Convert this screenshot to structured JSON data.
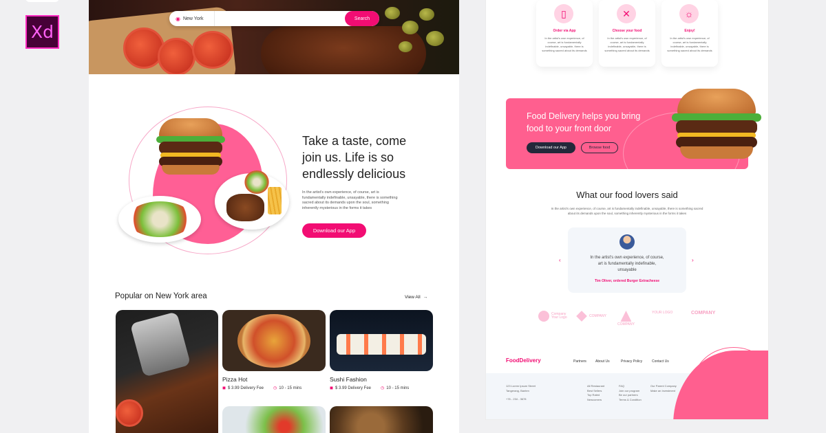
{
  "app": {
    "logo_text": "Xd",
    "accent_color": "#f20d73",
    "secondary_pink": "#ff5f8f"
  },
  "search": {
    "location": "New York",
    "button_label": "Search",
    "location_icon": "map-pin-icon"
  },
  "intro": {
    "title": "Take a taste, come join us. Life is so endlessly delicious",
    "body": "In the artist's own experience, of course, art is fundamentally indefinable, unsayable, there is something sacred about its demands upon the soul, something inherently mysterious in the forms it takes",
    "button_label": "Download our App"
  },
  "popular": {
    "title": "Popular on New York area",
    "view_all": "View All",
    "cards": [
      {
        "name": "Pizza Hot",
        "fee": "$ 3.99 Delivery Fee",
        "time": "10 - 15 mins"
      },
      {
        "name": "Sushi Fashion",
        "fee": "$ 3.99 Delivery Fee",
        "time": "10 - 15 mins"
      }
    ]
  },
  "steps": [
    {
      "title": "Order via App",
      "body": "In the artist's own experience, of course, art is fundamentally indefinable, unsayable, there is something sacred about its demands",
      "icon": "phone-icon"
    },
    {
      "title": "Choose your food",
      "body": "In the artist's own experience, of course, art is fundamentally indefinable, unsayable, there is something sacred about its demands",
      "icon": "fork-knife-icon"
    },
    {
      "title": "Enjoy!",
      "body": "In the artist's own experience, of course, art is fundamentally indefinable, unsayable, there is something sacred about its demands",
      "icon": "bike-icon"
    }
  ],
  "banner": {
    "title": "Food Delivery helps you bring food to your front door",
    "primary_button": "Download our App",
    "secondary_button": "Browse food"
  },
  "testimonials": {
    "title": "What our food lovers said",
    "subtitle": "In the artist's own experience, of course, art is fundamentally indefinable, unsayable, there is something sacred about its demands upon the soul, something inherently mysterious in the forms it takes",
    "quote": "In the artist's own experience, of course, art is fundamentally indefinable, unsayable",
    "author": "Tim Oliver, ordered Burger Extracheese"
  },
  "brands": [
    "Company Your Logo",
    "COMPANY",
    "COMPANY",
    "YOUR LOGO",
    "COMPANY"
  ],
  "footer": {
    "logo": "FoodDelivery",
    "nav": [
      "Partners",
      "About Us",
      "Privacy Policy",
      "Contact Us"
    ],
    "address": "123 Lorem Ipsum Street Tangerang, Banten",
    "phone": "+76 - 234 - 3678",
    "col1": [
      "All Restaurant",
      "Best Sellers",
      "Top Rated",
      "Newcomers"
    ],
    "col2": [
      "FAQ",
      "Join our program",
      "Be our partners",
      "Terms & Condition"
    ],
    "col3": [
      "Our Parent Company",
      "Make an Investment"
    ]
  }
}
